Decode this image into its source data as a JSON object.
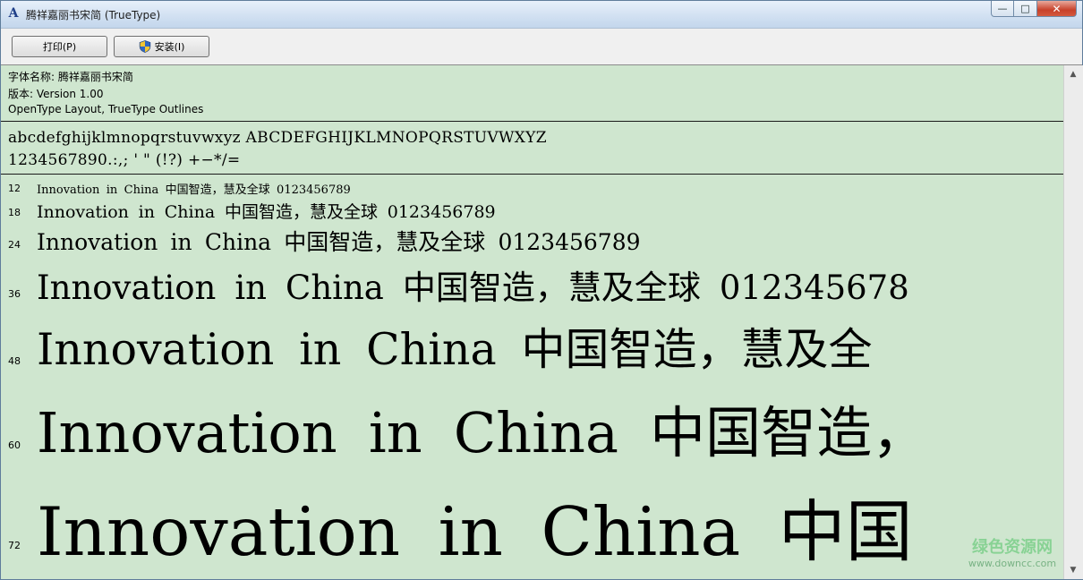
{
  "window": {
    "title": "腾祥嘉丽书宋简 (TrueType)",
    "controls": {
      "minimize": "—",
      "maximize": "□",
      "close": "✕"
    }
  },
  "toolbar": {
    "print_label": "打印(P)",
    "install_label": "安装(I)"
  },
  "font_info": {
    "name_line": "字体名称: 腾祥嘉丽书宋简",
    "version_line": "版本: Version  1.00",
    "type_line": "OpenType Layout, TrueType Outlines"
  },
  "charset": {
    "letters": "abcdefghijklmnopqrstuvwxyz  ABCDEFGHIJKLMNOPQRSTUVWXYZ",
    "digits": "1234567890.:,;  '  \"  (!?)  +−*/="
  },
  "samples": [
    {
      "size": "12",
      "text": "Innovation in China 中国智造，慧及全球 0123456789"
    },
    {
      "size": "18",
      "text": "Innovation in China 中国智造，慧及全球 0123456789"
    },
    {
      "size": "24",
      "text": "Innovation in China 中国智造，慧及全球 0123456789"
    },
    {
      "size": "36",
      "text": "Innovation in China 中国智造，慧及全球 012345678"
    },
    {
      "size": "48",
      "text": "Innovation in China 中国智造，慧及全"
    },
    {
      "size": "60",
      "text": "Innovation in China 中国智造，"
    },
    {
      "size": "72",
      "text": "Innovation in China 中国"
    }
  ],
  "watermark": {
    "brand": "绿色资源网",
    "url": "www.downcc.com"
  },
  "colors": {
    "preview_background": "#cfe6cf",
    "title_gradient_top": "#e7f0fa",
    "close_button": "#c7412a"
  }
}
